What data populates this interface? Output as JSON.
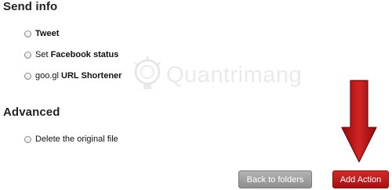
{
  "sections": {
    "send_info": {
      "heading": "Send info",
      "options": [
        {
          "prefix": "",
          "bold": "Tweet",
          "suffix": ""
        },
        {
          "prefix": "Set ",
          "bold": "Facebook status",
          "suffix": ""
        },
        {
          "prefix": "goo.gl ",
          "bold": "URL Shortener",
          "suffix": ""
        }
      ]
    },
    "advanced": {
      "heading": "Advanced",
      "options": [
        {
          "prefix": "Delete the original file",
          "bold": "",
          "suffix": ""
        }
      ]
    }
  },
  "buttons": {
    "back_label": "Back to folders",
    "add_label": "Add Action"
  },
  "watermark": {
    "text": "Quantrimang"
  },
  "colors": {
    "add_button": "#b81a1a",
    "back_button": "#9e9e9e",
    "arrow": "#b01212"
  }
}
